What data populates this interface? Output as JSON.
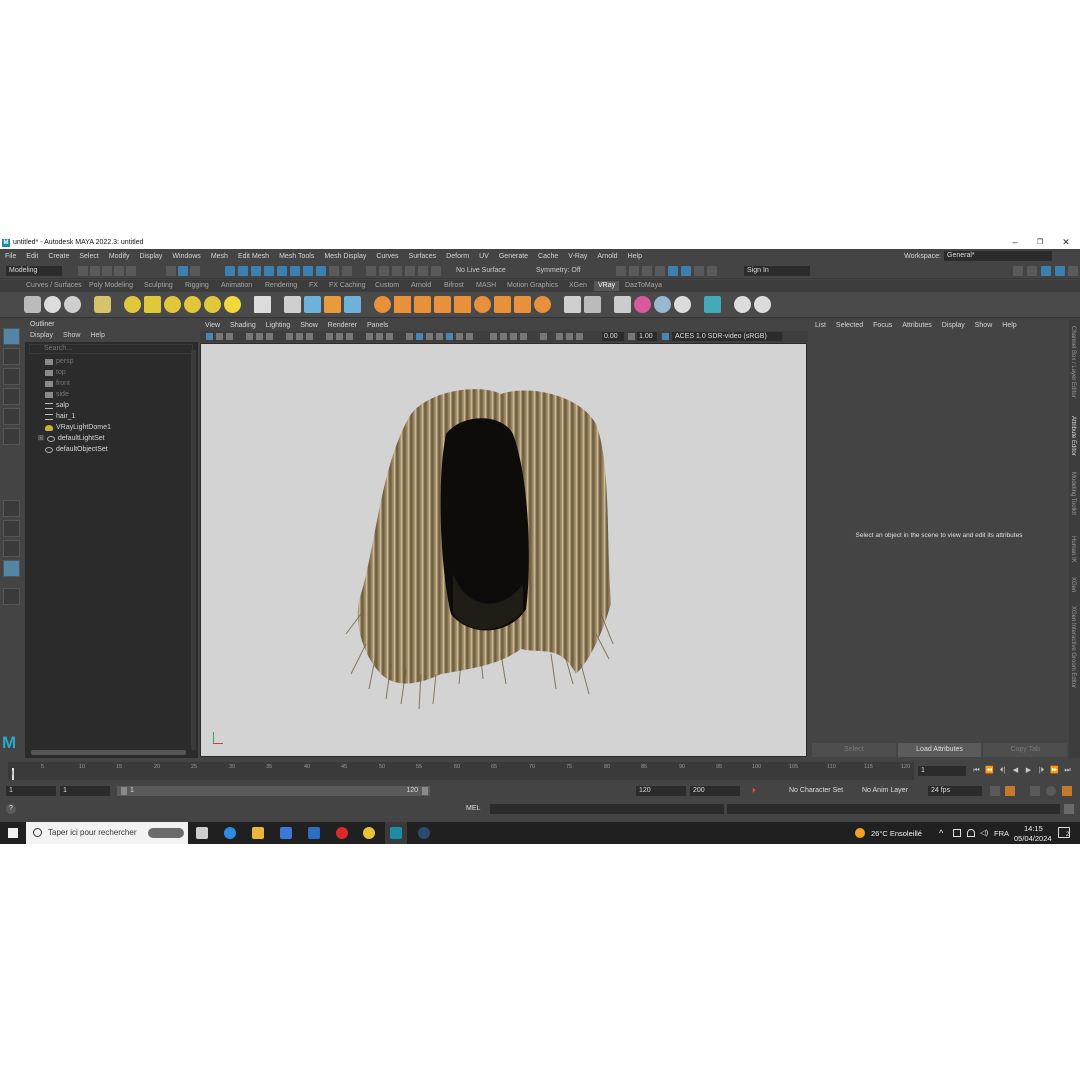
{
  "window": {
    "title": "untitled* - Autodesk MAYA 2022.3: untitled",
    "logo": "M",
    "controls": {
      "minimize": "–",
      "restore": "❐",
      "close": "✕"
    }
  },
  "menubar": {
    "items": [
      "File",
      "Edit",
      "Create",
      "Select",
      "Modify",
      "Display",
      "Windows",
      "Mesh",
      "Edit Mesh",
      "Mesh Tools",
      "Mesh Display",
      "Curves",
      "Surfaces",
      "Deform",
      "UV",
      "Generate",
      "Cache",
      "V-Ray",
      "Arnold",
      "Help"
    ],
    "workspace_label": "Workspace:",
    "workspace_value": "General*"
  },
  "statusline": {
    "mode": "Modeling",
    "live_surface": "No Live Surface",
    "symmetry": "Symmetry: Off",
    "sign_in": "Sign In"
  },
  "shelf_tabs": {
    "items": [
      "Curves / Surfaces",
      "Poly Modeling",
      "Sculpting",
      "Rigging",
      "Animation",
      "Rendering",
      "FX",
      "FX Caching",
      "Custom",
      "Arnold",
      "Bifrost",
      "MASH",
      "Motion Graphics",
      "XGen",
      "VRay",
      "DazToMaya"
    ],
    "active": "VRay"
  },
  "outliner": {
    "title": "Outliner",
    "menu": [
      "Display",
      "Show",
      "Help"
    ],
    "search_placeholder": "Search...",
    "items": [
      {
        "label": "persp",
        "icon": "camera-icon",
        "dim": true
      },
      {
        "label": "top",
        "icon": "camera-icon",
        "dim": true
      },
      {
        "label": "front",
        "icon": "camera-icon",
        "dim": true
      },
      {
        "label": "side",
        "icon": "camera-icon",
        "dim": true
      },
      {
        "label": "salp",
        "icon": "transform-icon",
        "dim": false
      },
      {
        "label": "hair_1",
        "icon": "transform-icon",
        "dim": false
      },
      {
        "label": "VRayLightDome1",
        "icon": "light-dome-icon",
        "dim": false
      },
      {
        "label": "defaultLightSet",
        "icon": "set-icon",
        "dim": false
      },
      {
        "label": "defaultObjectSet",
        "icon": "set-icon",
        "dim": false
      }
    ]
  },
  "viewport": {
    "menu": [
      "View",
      "Shading",
      "Lighting",
      "Show",
      "Renderer",
      "Panels"
    ],
    "exposure": "0.00",
    "gamma": "1.00",
    "colorspace": "ACES 1.0 SDR-video (sRGB)"
  },
  "attribute_editor": {
    "menu": [
      "List",
      "Selected",
      "Focus",
      "Attributes",
      "Display",
      "Show",
      "Help"
    ],
    "message": "Select an object in the scene to view and edit its attributes",
    "buttons": [
      "Select",
      "Load Attributes",
      "Copy Tab"
    ]
  },
  "side_tabs": [
    "Channel Box / Layer Editor",
    "Attribute Editor",
    "Modeling Toolkit",
    "Human IK",
    "XGen",
    "XGen Interactive Groom Editor"
  ],
  "timeline": {
    "ticks": [
      "5",
      "10",
      "15",
      "20",
      "25",
      "30",
      "35",
      "40",
      "45",
      "50",
      "55",
      "60",
      "65",
      "70",
      "75",
      "80",
      "85",
      "90",
      "95",
      "100",
      "105",
      "110",
      "115",
      "120"
    ],
    "first_tick": "1",
    "current_frame": "1",
    "playback": [
      "⏮",
      "⏪",
      "⏴|",
      "◀",
      "▶",
      "|⏵",
      "⏩",
      "⏭"
    ]
  },
  "range": {
    "start": "1",
    "playback_start": "1",
    "bar_start": "1",
    "bar_end": "120",
    "playback_end": "120",
    "end": "200",
    "character_set": "No Character Set",
    "anim_layer": "No Anim Layer",
    "fps": "24 fps"
  },
  "command_line": {
    "lang": "MEL",
    "help": "?"
  },
  "taskbar": {
    "search_placeholder": "Taper ici pour rechercher",
    "weather": "26°C  Ensoleillé",
    "lang": "FRA",
    "time": "14:15",
    "date": "05/04/2024",
    "notifications": "2"
  },
  "colors": {
    "maya_bg": "#444444",
    "viewport_bg": "#d3d3d3",
    "accent": "#4b85b6",
    "hair": "#8f7a58"
  }
}
